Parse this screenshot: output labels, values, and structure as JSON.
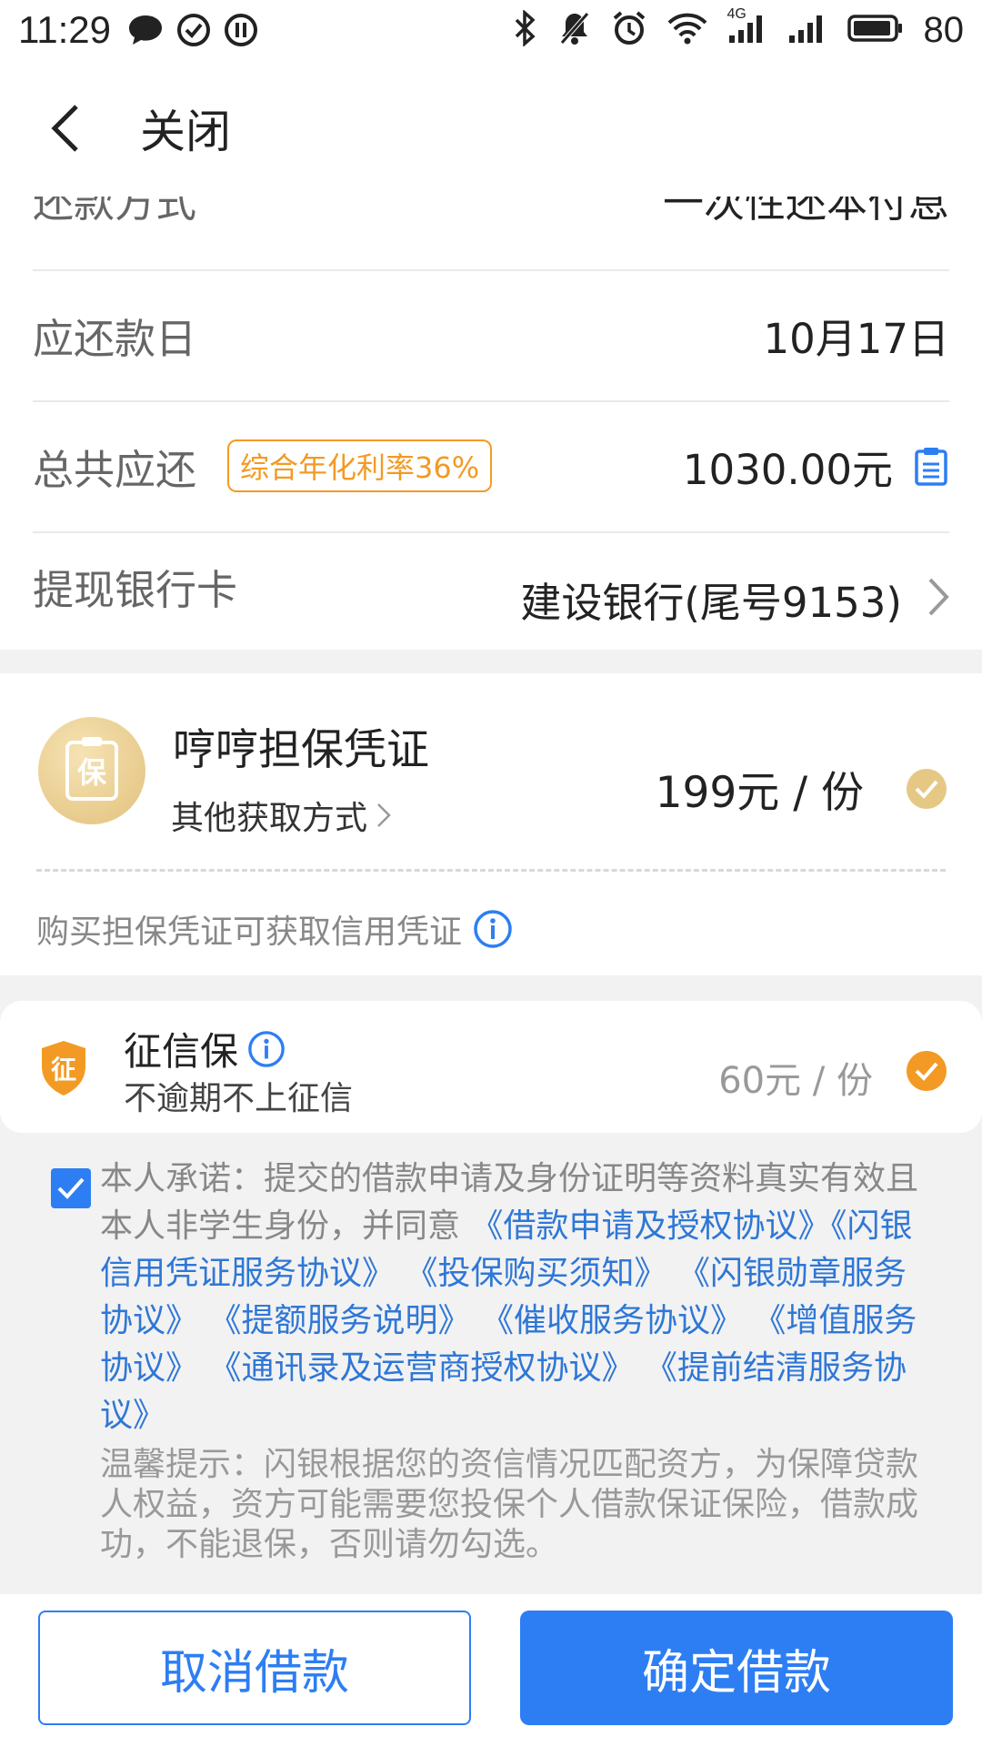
{
  "status_bar": {
    "time": "11:29",
    "network_label": "4G",
    "battery": "80"
  },
  "nav": {
    "close_label": "关闭"
  },
  "info": {
    "repay_method_label": "还款方式",
    "repay_method_value": "一次性还本付息",
    "due_date_label": "应还款日",
    "due_date_value": "10月17日",
    "total_label": "总共应还",
    "rate_tag": "综合年化利率36%",
    "total_value": "1030.00元",
    "bank_label": "提现银行卡",
    "bank_value": "建设银行(尾号9153)"
  },
  "guarantee": {
    "icon_char": "保",
    "title": "哼哼担保凭证",
    "other_ways": "其他获取方式",
    "price": "199元 / 份",
    "note": "购买担保凭证可获取信用凭证"
  },
  "credit_insurance": {
    "icon_char": "征",
    "title": "征信保",
    "subtitle": "不逾期不上征信",
    "price": "60元 / 份"
  },
  "agreement": {
    "intro": "本人承诺：提交的借款申请及身份证明等资料真实有效且本人非学生身份，并同意",
    "links": [
      "《借款申请及授权协议》",
      "《闪银信用凭证服务协议》",
      "《投保购买须知》",
      "《闪银勋章服务协议》",
      "《提额服务说明》",
      "《催收服务协议》",
      "《增值服务协议》",
      "《通讯录及运营商授权协议》",
      "《提前结清服务协议》"
    ],
    "tip": "温馨提示：闪银根据您的资信情况匹配资方，为保障贷款人权益，资方可能需要您投保个人借款保证保险，借款成功，不能退保，否则请勿勾选。"
  },
  "buttons": {
    "cancel": "取消借款",
    "confirm": "确定借款"
  },
  "colors": {
    "primary": "#2d7ef3",
    "link": "#2f77d6",
    "orange": "#f39a24",
    "gold": "#e6c885"
  }
}
